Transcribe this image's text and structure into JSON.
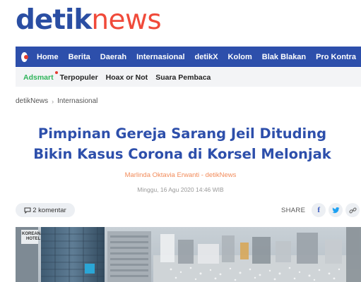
{
  "brand": {
    "part1": "detik",
    "part2": "news"
  },
  "nav": {
    "items": [
      "Home",
      "Berita",
      "Daerah",
      "Internasional",
      "detikX",
      "Kolom",
      "Blak Blakan",
      "Pro Kontra"
    ]
  },
  "subnav": {
    "items": [
      "Adsmart",
      "Terpopuler",
      "Hoax or Not",
      "Suara Pembaca"
    ]
  },
  "breadcrumb": {
    "root": "detikNews",
    "section": "Internasional"
  },
  "article": {
    "title_line1": "Pimpinan Gereja Sarang Jeil Dituding",
    "title_line2": "Bikin Kasus Corona di Korsel Melonjak",
    "author": "Marlinda Oktavia Erwanti - detikNews",
    "date": "Minggu, 16 Agu 2020 14:46 WIB"
  },
  "comments": {
    "label": "2 komentar"
  },
  "share": {
    "label": "SHARE",
    "facebook": "f"
  },
  "photo": {
    "signage": "KOREANA HOTEL"
  },
  "colors": {
    "brand_blue": "#2d4fab",
    "brand_red": "#f04a3a",
    "adsmart_green": "#2fb45a",
    "author_orange": "#f28c5b"
  },
  "icons": [
    "detik-logo-icon",
    "comment-icon",
    "facebook-icon",
    "twitter-icon",
    "link-icon"
  ]
}
